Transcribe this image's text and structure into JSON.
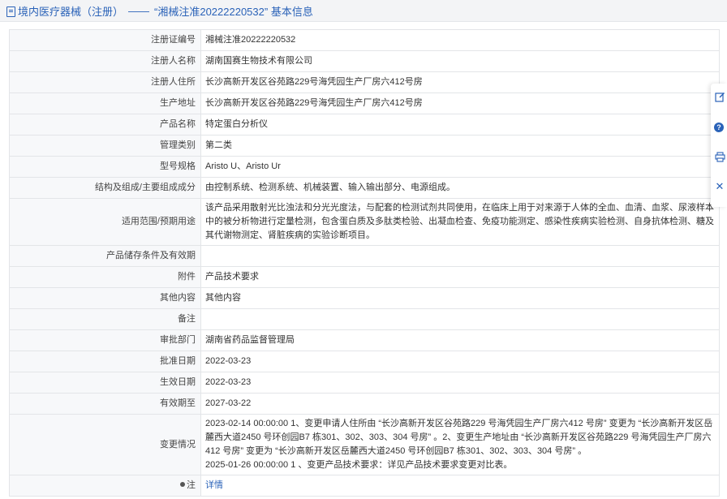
{
  "header": {
    "breadcrumb": "境内医疗器械（注册）",
    "separator": "——",
    "title": "“湘械注准20222220532” 基本信息"
  },
  "rows": [
    {
      "label": "注册证编号",
      "value": "湘械注准20222220532"
    },
    {
      "label": "注册人名称",
      "value": "湖南国赛生物技术有限公司"
    },
    {
      "label": "注册人住所",
      "value": "长沙高新开发区谷苑路229号海凭园生产厂房六412号房"
    },
    {
      "label": "生产地址",
      "value": "长沙高新开发区谷苑路229号海凭园生产厂房六412号房"
    },
    {
      "label": "产品名称",
      "value": "特定蛋白分析仪"
    },
    {
      "label": "管理类别",
      "value": "第二类"
    },
    {
      "label": "型号规格",
      "value": "Aristo U、Aristo Ur"
    },
    {
      "label": "结构及组成/主要组成成分",
      "value": "由控制系统、检测系统、机械装置、输入输出部分、电源组成。"
    },
    {
      "label": "适用范围/预期用途",
      "value": "该产品采用散射光比浊法和分光光度法，与配套的检测试剂共同使用，在临床上用于对来源于人体的全血、血清、血浆、尿液样本中的被分析物进行定量检测，包含蛋白质及多肽类检验、出凝血检查、免疫功能测定、感染性疾病实验检测、自身抗体检测、糖及其代谢物测定、肾脏疾病的实验诊断项目。"
    },
    {
      "label": "产品储存条件及有效期",
      "value": ""
    },
    {
      "label": "附件",
      "value": "产品技术要求"
    },
    {
      "label": "其他内容",
      "value": "其他内容"
    },
    {
      "label": "备注",
      "value": ""
    },
    {
      "label": "审批部门",
      "value": "湖南省药品监督管理局"
    },
    {
      "label": "批准日期",
      "value": "2022-03-23"
    },
    {
      "label": "生效日期",
      "value": "2022-03-23"
    },
    {
      "label": "有效期至",
      "value": "2027-03-22"
    }
  ],
  "changes": {
    "label": "变更情况",
    "line1": "2023-02-14 00:00:00 1、变更申请人住所由 “长沙高新开发区谷苑路229 号海凭园生产厂房六412 号房” 变更为 “长沙高新开发区岳麓西大道2450 号环创园B7 栋301、302、303、304 号房” 。2、变更生产地址由 “长沙高新开发区谷苑路229 号海凭园生产厂房六412 号房” 变更为 “长沙高新开发区岳麓西大道2450 号环创园B7 栋301、302、303、304 号房” 。",
    "line2": "2025-01-26 00:00:00 1 、变更产品技术要求：详见产品技术要求变更对比表。"
  },
  "note": {
    "label": "注",
    "link": "详情"
  },
  "toolbar": {
    "icons": [
      "edit-icon",
      "help-icon",
      "print-icon",
      "close-icon"
    ],
    "help_glyph": "?",
    "close_glyph": "✕"
  },
  "colors": {
    "link": "#2a62b8",
    "label_bg": "#f7f8fa",
    "border": "#e3e5e8"
  }
}
